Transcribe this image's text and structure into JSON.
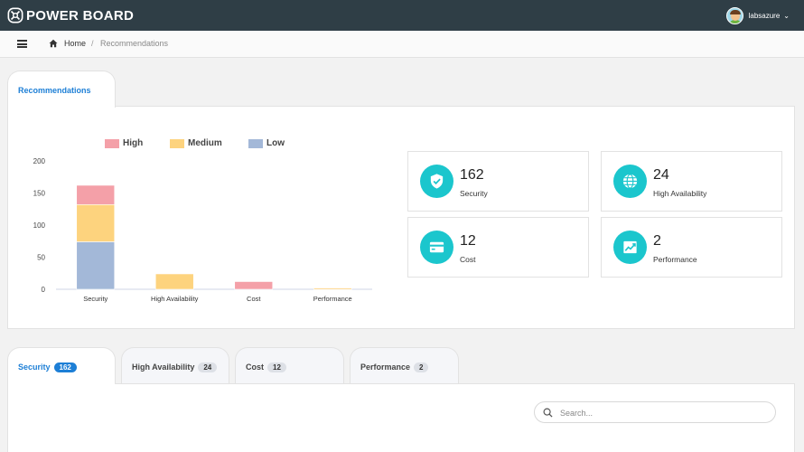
{
  "app": {
    "name": "POWER BOARD"
  },
  "user": {
    "name": "labsazure"
  },
  "breadcrumb": {
    "home": "Home",
    "separator": "/",
    "current": "Recommendations"
  },
  "main_tab": {
    "label": "Recommendations"
  },
  "chart_data": {
    "type": "bar",
    "stacked": true,
    "categories": [
      "Security",
      "High Availability",
      "Cost",
      "Performance"
    ],
    "series": [
      {
        "name": "Low",
        "color": "#a3b8d8",
        "values": [
          74,
          0,
          0,
          0
        ]
      },
      {
        "name": "Medium",
        "color": "#fdd37e",
        "values": [
          58,
          24,
          0,
          2
        ]
      },
      {
        "name": "High",
        "color": "#f4a0a8",
        "values": [
          30,
          0,
          12,
          0
        ]
      }
    ],
    "legend": [
      "High",
      "Medium",
      "Low"
    ],
    "yticks": [
      0,
      50,
      100,
      150,
      200
    ],
    "ylim": [
      0,
      200
    ],
    "legend_position": "top",
    "grid": false
  },
  "cards": [
    {
      "value": "162",
      "label": "Security",
      "icon": "shield-check-icon"
    },
    {
      "value": "24",
      "label": "High Availability",
      "icon": "globe-icon"
    },
    {
      "value": "12",
      "label": "Cost",
      "icon": "credit-card-icon"
    },
    {
      "value": "2",
      "label": "Performance",
      "icon": "chart-trend-icon"
    }
  ],
  "bottom_tabs": [
    {
      "label": "Security",
      "count": "162"
    },
    {
      "label": "High Availability",
      "count": "24"
    },
    {
      "label": "Cost",
      "count": "12"
    },
    {
      "label": "Performance",
      "count": "2"
    }
  ],
  "search": {
    "placeholder": "Search..."
  },
  "colors": {
    "topbar": "#2f3e46",
    "accent": "#1d7fd6",
    "card_icon": "#1bc6cd"
  }
}
